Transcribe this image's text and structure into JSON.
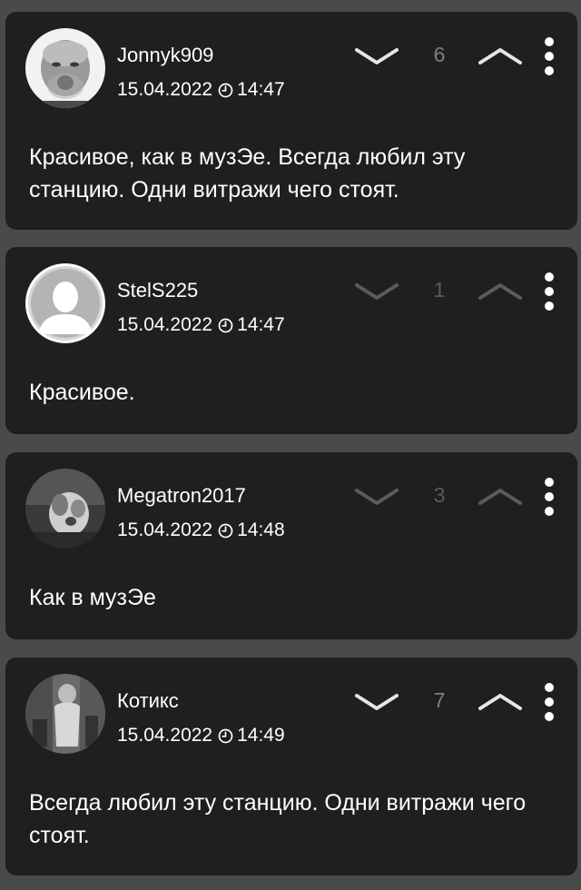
{
  "comments": [
    {
      "username": "Jonnyk909",
      "date": "15.04.2022",
      "time": "14:47",
      "score": "6",
      "text": "Красивое, как в музЭе. Всегда любил эту станцию. Одни витражи чего стоят.",
      "avatar_icon": "angry-man-photo",
      "votes_active": true
    },
    {
      "username": "StelS225",
      "date": "15.04.2022",
      "time": "14:47",
      "score": "1",
      "text": "Красивое.",
      "avatar_icon": "default-user-silhouette",
      "votes_active": false
    },
    {
      "username": "Megatron2017",
      "date": "15.04.2022",
      "time": "14:48",
      "score": "3",
      "text": "Как в музЭе",
      "avatar_icon": "dog-photo",
      "votes_active": false
    },
    {
      "username": "Котикс",
      "date": "15.04.2022",
      "time": "14:49",
      "score": "7",
      "text": "Всегда любил эту станцию. Одни витражи чего стоят.",
      "avatar_icon": "figure-photo",
      "votes_active": true
    }
  ],
  "colors": {
    "background": "#4a4a4a",
    "card": "#1f1f1f",
    "score": "#7f7f7f",
    "chevron_active": "#e6e6e6",
    "chevron_inactive": "#5c5c5c"
  }
}
